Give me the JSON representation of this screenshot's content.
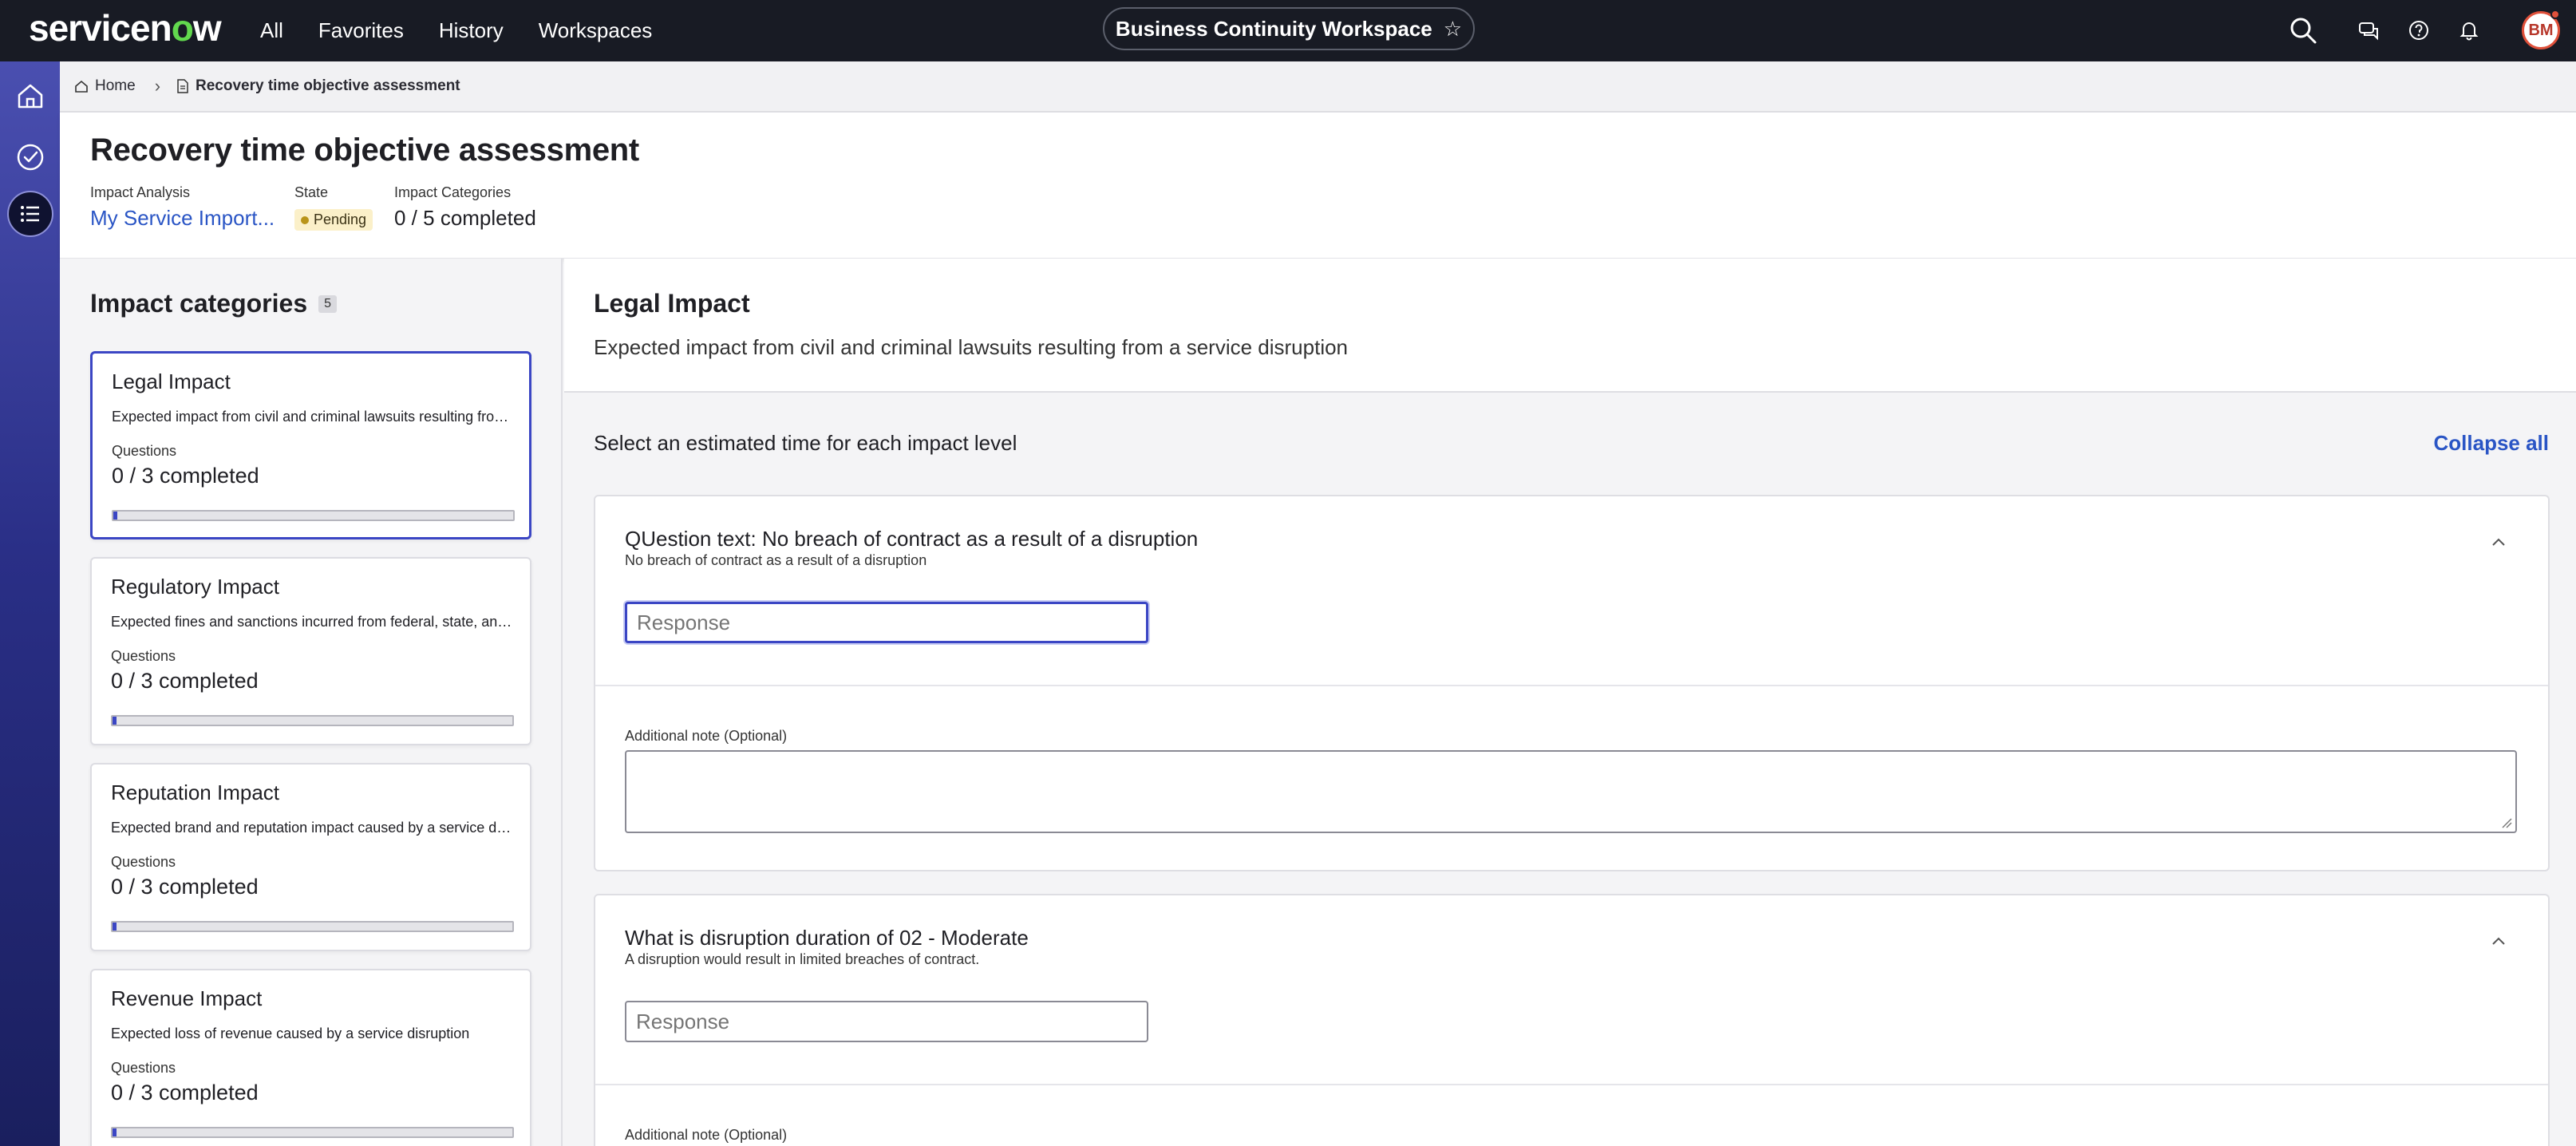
{
  "topnav": {
    "logo_pre": "servicen",
    "logo_o": "o",
    "logo_post": "w",
    "links": [
      "All",
      "Favorites",
      "History",
      "Workspaces"
    ],
    "workspace": "Business Continuity Workspace",
    "avatar_initials": "BM"
  },
  "breadcrumb": {
    "home": "Home",
    "current": "Recovery time objective assessment"
  },
  "header": {
    "title": "Recovery time objective assessment",
    "impact_analysis_label": "Impact Analysis",
    "impact_analysis_value": "My Service Import...",
    "state_label": "State",
    "state_value": "Pending",
    "impact_categories_label": "Impact Categories",
    "impact_categories_value": "0 / 5 completed"
  },
  "left_panel": {
    "title": "Impact categories",
    "count": "5",
    "categories": [
      {
        "name": "Legal Impact",
        "desc": "Expected impact from civil and criminal lawsuits resulting from a service disruption",
        "questions_label": "Questions",
        "questions_value": "0 / 3 completed",
        "progress": 0.01
      },
      {
        "name": "Regulatory Impact",
        "desc": "Expected fines and sanctions incurred from federal, state, and local regulators",
        "questions_label": "Questions",
        "questions_value": "0 / 3 completed",
        "progress": 0.01
      },
      {
        "name": "Reputation Impact",
        "desc": "Expected brand and reputation impact caused by a service disruption",
        "questions_label": "Questions",
        "questions_value": "0 / 3 completed",
        "progress": 0.01
      },
      {
        "name": "Revenue Impact",
        "desc": "Expected loss of revenue caused by a service disruption",
        "questions_label": "Questions",
        "questions_value": "0 / 3 completed",
        "progress": 0.01
      }
    ]
  },
  "right_panel": {
    "title": "Legal Impact",
    "desc": "Expected impact from civil and criminal lawsuits resulting from a service disruption",
    "instruction": "Select an estimated time for each impact level",
    "collapse_all": "Collapse all",
    "questions": [
      {
        "title": "QUestion text: No breach of contract as a result of a disruption",
        "subtitle": "No breach of contract as a result of a disruption",
        "response_placeholder": "Response",
        "note_label": "Additional note (Optional)"
      },
      {
        "title": "What is disruption duration of 02 - Moderate",
        "subtitle": "A disruption would result in limited breaches of contract.",
        "response_placeholder": "Response",
        "note_label": "Additional note (Optional)"
      }
    ]
  },
  "colors": {
    "nav_bg": "#181b24",
    "accent": "#3b46c4",
    "link": "#2a55c5",
    "logo_o": "#62d84e"
  }
}
